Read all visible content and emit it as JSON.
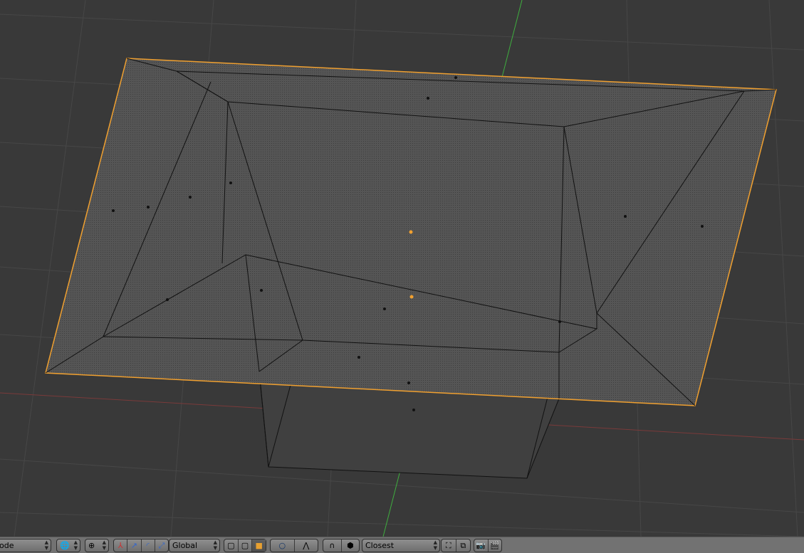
{
  "header": {
    "mode_label": "ode",
    "orientation_label": "Global",
    "snap_element_label": "Closest"
  },
  "icons": [
    "globe-icon",
    "pivot-icon",
    "manipulator-icon",
    "translate-icon",
    "rotate-icon",
    "scale-icon",
    "solid-shading-icon",
    "wireframe-shading-icon",
    "texture-shading-icon",
    "proportional-edit-icon",
    "falloff-icon",
    "magnet-icon",
    "snap-target-icon",
    "snap-closest-icon",
    "render-icon",
    "animation-render-icon"
  ],
  "colors": {
    "viewport_bg": "#393939",
    "grid": "#4a4a4a",
    "selection_outline": "#f0a030",
    "y_axis": "#3fae3f",
    "x_axis": "#8a4040",
    "header_bg": "#727272"
  }
}
